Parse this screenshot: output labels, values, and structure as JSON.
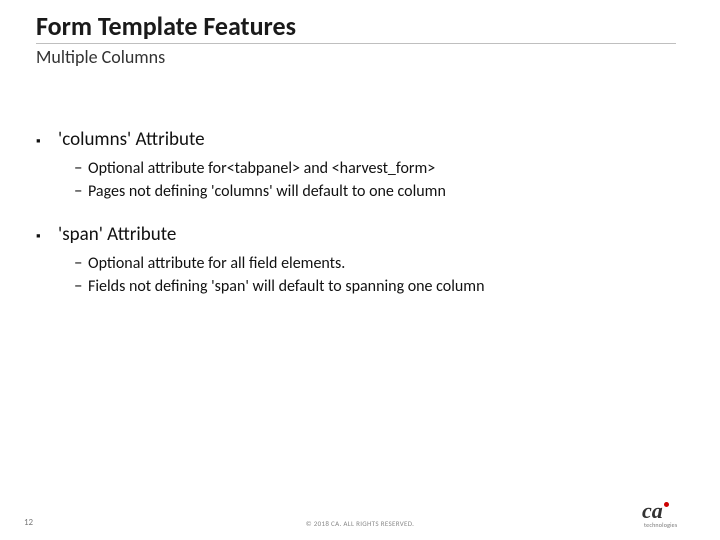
{
  "header": {
    "title": "Form Template Features",
    "subtitle": "Multiple Columns"
  },
  "sections": [
    {
      "heading": "'columns' Attribute",
      "items": [
        "Optional attribute for<tabpanel> and <harvest_form>",
        "Pages not defining 'columns' will default to one column"
      ]
    },
    {
      "heading": "'span' Attribute",
      "items": [
        "Optional attribute for all field elements.",
        "Fields not defining 'span' will default to spanning one column"
      ]
    }
  ],
  "footer": {
    "page_number": "12",
    "copyright": "© 2018 CA. ALL RIGHTS RESERVED.",
    "logo_brand": "ca",
    "logo_sub": "technologies"
  }
}
